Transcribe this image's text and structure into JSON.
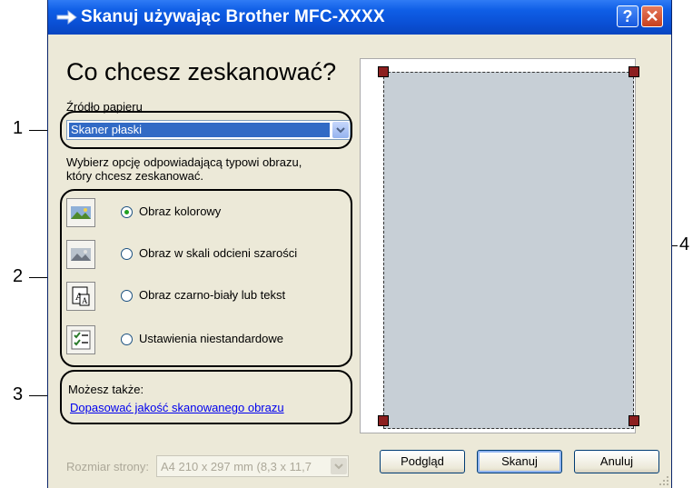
{
  "window": {
    "title": "Skanuj używając Brother MFC-XXXX",
    "help_button": "?",
    "close_button": "✕"
  },
  "main": {
    "heading": "Co chcesz zeskanować?",
    "paper_source_label": "Źródło papieru",
    "paper_source_value": "Skaner płaski",
    "instruction_line1": "Wybierz opcję odpowiadającą typowi obrazu,",
    "instruction_line2": "który chcesz zeskanować.",
    "options": [
      {
        "label": "Obraz kolorowy",
        "selected": true,
        "icon": "color-photo-icon"
      },
      {
        "label": "Obraz w skali odcieni szarości",
        "selected": false,
        "icon": "grayscale-photo-icon"
      },
      {
        "label": "Obraz czarno-biały lub tekst",
        "selected": false,
        "icon": "bw-text-icon"
      },
      {
        "label": "Ustawienia niestandardowe",
        "selected": false,
        "icon": "custom-settings-icon"
      }
    ],
    "also_label": "Możesz także:",
    "adjust_link": "Dopasować jakość skanowanego obrazu"
  },
  "footer": {
    "page_size_label": "Rozmiar strony:",
    "page_size_value": "A4 210 x 297 mm (8,3 x 11,7",
    "preview_button": "Podgląd",
    "scan_button": "Skanuj",
    "cancel_button": "Anuluj"
  },
  "callouts": [
    "1",
    "2",
    "3",
    "4"
  ],
  "colors": {
    "titlebar": "#0a4fd4",
    "dialog_bg": "#ece9d8",
    "selection": "#316ac5",
    "preview_area": "#c7cfd6",
    "crop_handle": "#8c1f1f",
    "link": "#0000ee"
  }
}
